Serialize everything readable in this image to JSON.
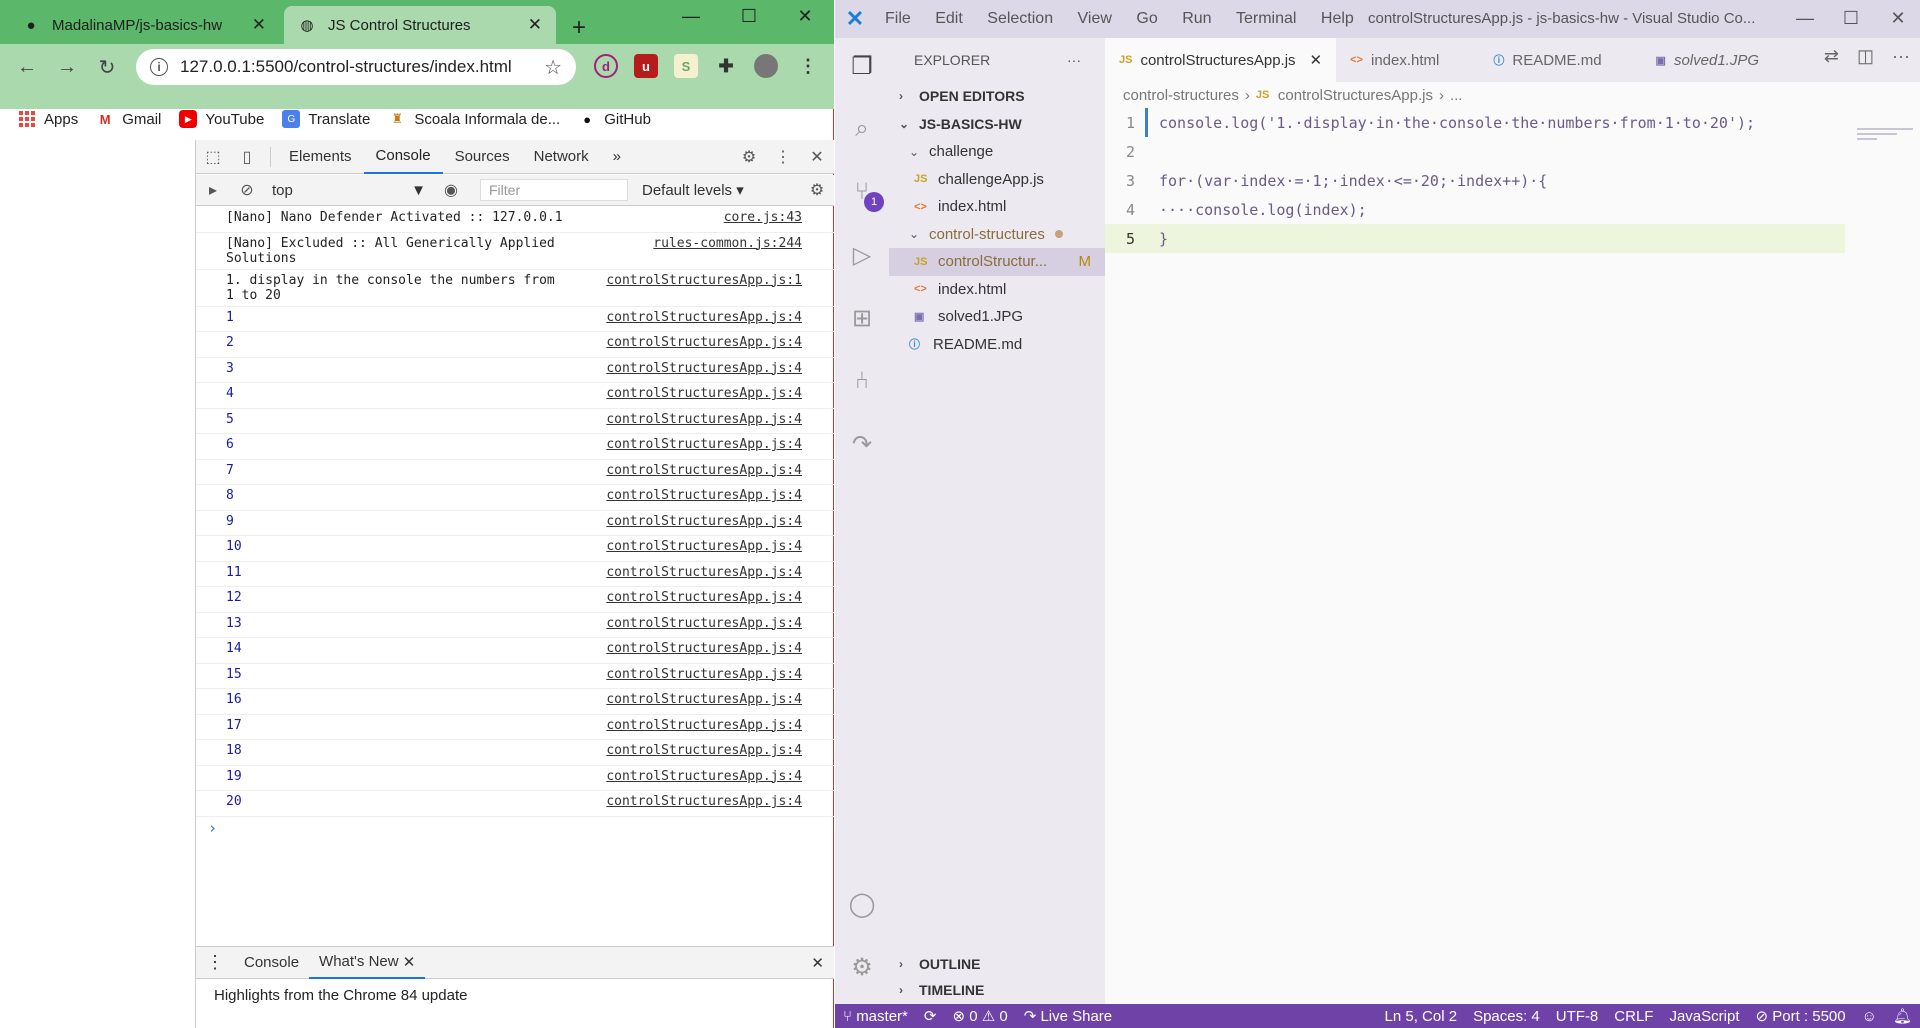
{
  "chrome": {
    "tabs": [
      {
        "title": "MadalinaMP/js-basics-hw",
        "icon": "github-icon"
      },
      {
        "title": "JS Control Structures",
        "icon": "globe-icon"
      }
    ],
    "url": "127.0.0.1:5500/control-structures/index.html",
    "bookmarks": [
      {
        "label": "Apps",
        "icon": "apps-grid-icon"
      },
      {
        "label": "Gmail",
        "icon": "gmail-icon"
      },
      {
        "label": "YouTube",
        "icon": "youtube-icon"
      },
      {
        "label": "Translate",
        "icon": "translate-icon"
      },
      {
        "label": "Scoala Informala de...",
        "icon": "scoala-icon"
      },
      {
        "label": "GitHub",
        "icon": "github-icon"
      }
    ]
  },
  "devtools": {
    "tabs": [
      "Elements",
      "Console",
      "Sources",
      "Network"
    ],
    "more": "»",
    "context": "top",
    "filter_placeholder": "Filter",
    "levels": "Default levels",
    "log": [
      {
        "msg": "[Nano] Nano Defender Activated :: 127.0.0.1",
        "src": "core.js:43"
      },
      {
        "msg": "[Nano] Excluded :: All Generically Applied\nSolutions",
        "src": "rules-common.js:244"
      },
      {
        "msg": "1. display in the console the numbers from\n1 to 20",
        "src": "controlStructuresApp.js:1"
      },
      {
        "msg": "1",
        "src": "controlStructuresApp.js:4"
      },
      {
        "msg": "2",
        "src": "controlStructuresApp.js:4"
      },
      {
        "msg": "3",
        "src": "controlStructuresApp.js:4"
      },
      {
        "msg": "4",
        "src": "controlStructuresApp.js:4"
      },
      {
        "msg": "5",
        "src": "controlStructuresApp.js:4"
      },
      {
        "msg": "6",
        "src": "controlStructuresApp.js:4"
      },
      {
        "msg": "7",
        "src": "controlStructuresApp.js:4"
      },
      {
        "msg": "8",
        "src": "controlStructuresApp.js:4"
      },
      {
        "msg": "9",
        "src": "controlStructuresApp.js:4"
      },
      {
        "msg": "10",
        "src": "controlStructuresApp.js:4"
      },
      {
        "msg": "11",
        "src": "controlStructuresApp.js:4"
      },
      {
        "msg": "12",
        "src": "controlStructuresApp.js:4"
      },
      {
        "msg": "13",
        "src": "controlStructuresApp.js:4"
      },
      {
        "msg": "14",
        "src": "controlStructuresApp.js:4"
      },
      {
        "msg": "15",
        "src": "controlStructuresApp.js:4"
      },
      {
        "msg": "16",
        "src": "controlStructuresApp.js:4"
      },
      {
        "msg": "17",
        "src": "controlStructuresApp.js:4"
      },
      {
        "msg": "18",
        "src": "controlStructuresApp.js:4"
      },
      {
        "msg": "19",
        "src": "controlStructuresApp.js:4"
      },
      {
        "msg": "20",
        "src": "controlStructuresApp.js:4"
      }
    ],
    "drawer": {
      "tabs": [
        "Console",
        "What's New"
      ],
      "body": "Highlights from the Chrome 84 update"
    }
  },
  "vscode": {
    "menu": [
      "File",
      "Edit",
      "Selection",
      "View",
      "Go",
      "Run",
      "Terminal",
      "Help"
    ],
    "window_title": "controlStructuresApp.js - js-basics-hw - Visual Studio Co...",
    "explorer": {
      "title": "EXPLORER",
      "open_editors": "OPEN EDITORS",
      "root": "JS-BASICS-HW",
      "tree": [
        {
          "label": "challenge",
          "type": "folder",
          "indent": 1
        },
        {
          "label": "challengeApp.js",
          "type": "js",
          "indent": 2
        },
        {
          "label": "index.html",
          "type": "html",
          "indent": 2
        },
        {
          "label": "control-structures",
          "type": "folder",
          "indent": 1
        },
        {
          "label": "controlStructur...",
          "type": "js",
          "indent": 2,
          "status": "M"
        },
        {
          "label": "index.html",
          "type": "html",
          "indent": 2
        },
        {
          "label": "solved1.JPG",
          "type": "img",
          "indent": 2
        },
        {
          "label": "README.md",
          "type": "info",
          "indent": 1
        }
      ],
      "outline": "OUTLINE",
      "timeline": "TIMELINE"
    },
    "editor_tabs": [
      {
        "label": "controlStructuresApp.js",
        "icon": "JS"
      },
      {
        "label": "index.html",
        "icon": "<>"
      },
      {
        "label": "README.md",
        "icon": "ⓘ"
      },
      {
        "label": "solved1.JPG",
        "icon": "▣"
      }
    ],
    "breadcrumb": [
      "control-structures",
      "controlStructuresApp.js",
      "..."
    ],
    "code": [
      "console.log('1.·display·in·the·console·the·numbers·from·1·to·20');",
      "",
      "for·(var·index·=·1;·index·<=·20;·index++)·{",
      "····console.log(index);",
      "}"
    ],
    "scm_badge": "1",
    "status": {
      "branch": "master*",
      "errors": "0",
      "warnings": "0",
      "live_share": "Live Share",
      "position": "Ln 5, Col 2",
      "spaces": "Spaces: 4",
      "encoding": "UTF-8",
      "eol": "CRLF",
      "language": "JavaScript",
      "port": "Port : 5500"
    }
  },
  "colors": {
    "chrome_frame": "#5bb86b",
    "chrome_toolbar": "#a9d9ad",
    "vscode_statusbar": "#6f42a8",
    "vscode_titlebar": "#ddd8e8"
  }
}
